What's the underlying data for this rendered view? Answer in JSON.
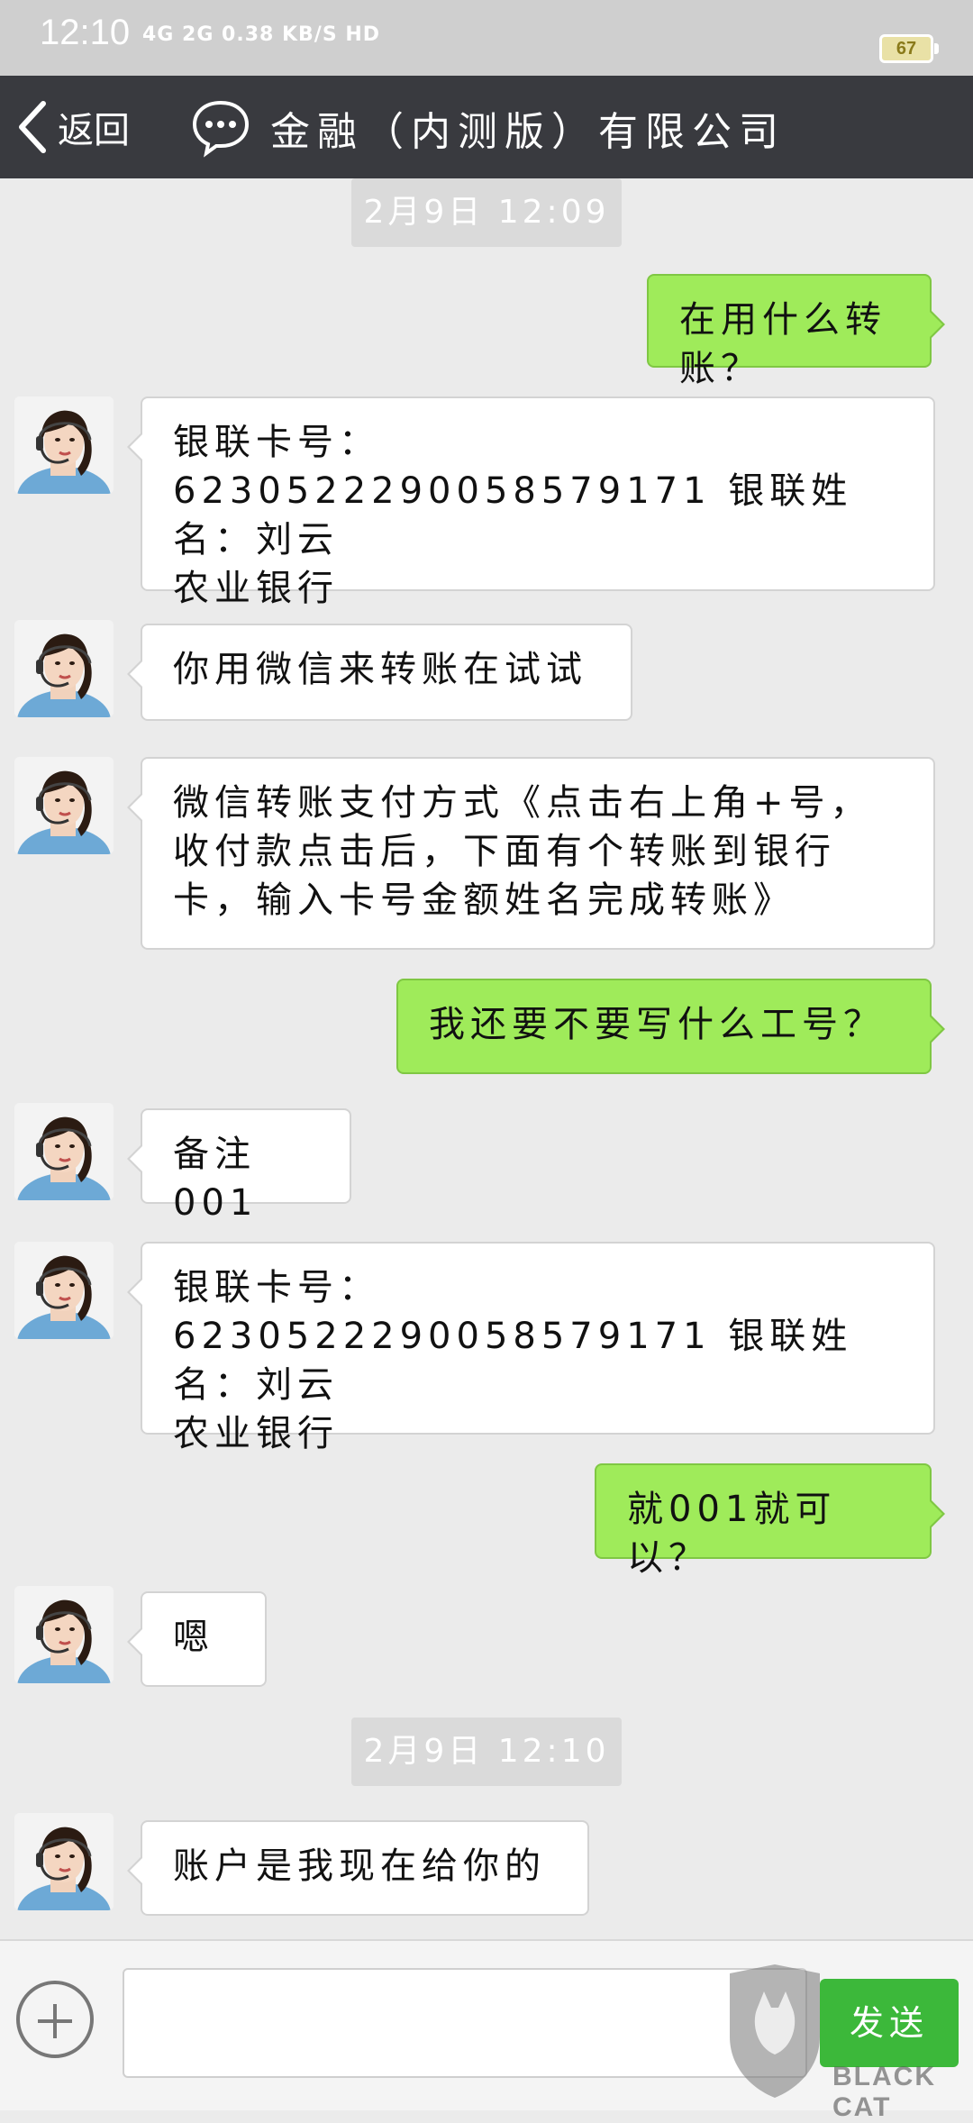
{
  "status_bar": {
    "time": "12:10",
    "signal_text": "4G 2G 0.38 KB/S HD",
    "battery": "67"
  },
  "header": {
    "back_label": "返回",
    "title": "金融（内测版）有限公司"
  },
  "messages": [
    {
      "type": "time",
      "text": "2月9日 12:09"
    },
    {
      "type": "sent",
      "text": "在用什么转账？"
    },
    {
      "type": "received",
      "text": "银联卡号：6230522290058579171 银联姓名：刘云\n农业银行"
    },
    {
      "type": "received",
      "text": "你用微信来转账在试试"
    },
    {
      "type": "received",
      "text": "微信转账支付方式《点击右上角+号，收付款点击后，下面有个转账到银行卡，输入卡号金额姓名完成转账》"
    },
    {
      "type": "sent",
      "text": "我还要不要写什么工号？"
    },
    {
      "type": "received",
      "text": "备注001"
    },
    {
      "type": "received",
      "text": "银联卡号：6230522290058579171 银联姓名：刘云\n农业银行"
    },
    {
      "type": "sent",
      "text": "就001就可以？"
    },
    {
      "type": "received",
      "text": "嗯"
    },
    {
      "type": "time",
      "text": "2月9日 12:10"
    },
    {
      "type": "received",
      "text": "账户是我现在给你的"
    }
  ],
  "input_bar": {
    "placeholder": "",
    "send_label": "发送"
  },
  "watermark": {
    "text": "BLACK CAT"
  },
  "colors": {
    "header_bg": "#393a3f",
    "sent_bubble": "#9feb5a",
    "received_bubble": "#ffffff",
    "chat_bg": "#ebebeb",
    "send_button": "#3cb83a"
  },
  "icons": {
    "back": "chevron-left-icon",
    "chat": "chat-bubble-icon",
    "plus": "plus-circle-icon"
  }
}
